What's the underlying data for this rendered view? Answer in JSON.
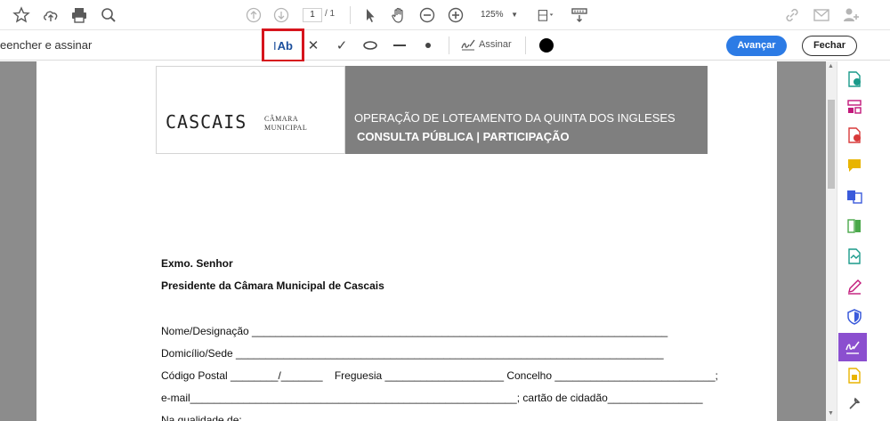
{
  "toolbar": {
    "page_current": "1",
    "page_total": "/ 1",
    "zoom": "125%",
    "icons": [
      "star-icon",
      "cloud-upload-icon",
      "print-icon",
      "zoom-icon",
      "arrow-up-icon",
      "arrow-down-icon",
      "select-arrow-icon",
      "hand-icon",
      "zoom-out-icon",
      "zoom-in-icon",
      "page-fit-icon",
      "scroll-mode-icon",
      "link-icon",
      "mail-icon",
      "add-user-icon"
    ]
  },
  "fill_sign": {
    "title": "eencher e assinar",
    "text_tool": "Ab",
    "cross_tool": "✕",
    "check_tool": "✓",
    "sign_label": "Assinar",
    "advance_button": "Avançar",
    "close_button": "Fechar",
    "active_color": "#d6141d"
  },
  "document": {
    "logo_text": "CASCAIS",
    "logo_sub_1": "CÂMARA",
    "logo_sub_2": "MUNICIPAL",
    "header_line1": "OPERAÇÃO DE LOTEAMENTO DA QUINTA DOS INGLESES",
    "header_line2": "CONSULTA PÚBLICA | PARTICIPAÇÃO",
    "salutation": "Exmo. Senhor",
    "recipient": "Presidente da Câmara Municipal de Cascais",
    "field_name": "Nome/Designação ______________________________________________________________________",
    "field_address": "Domicílio/Sede ________________________________________________________________________",
    "field_postal": "Código Postal ________/_______    Freguesia ____________________ Concelho ___________________________;",
    "field_email": "e-mail_______________________________________________________; cartão de cidadão________________",
    "field_quality": "Na qualidade de:"
  },
  "colors": {
    "brand_blue": "#2c7be5",
    "header_gray": "#7f7f7f",
    "rail_active": "#8b4fcf"
  }
}
